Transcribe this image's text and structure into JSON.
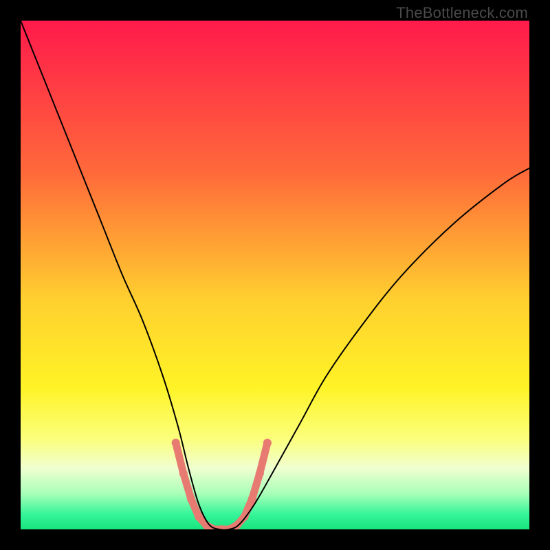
{
  "watermark": "TheBottleneck.com",
  "chart_data": {
    "type": "line",
    "title": "",
    "xlabel": "",
    "ylabel": "",
    "xlim": [
      0,
      100
    ],
    "ylim": [
      0,
      100
    ],
    "background_gradient": {
      "stops": [
        {
          "offset": 0.0,
          "color": "#ff1a4b"
        },
        {
          "offset": 0.3,
          "color": "#ff6a3a"
        },
        {
          "offset": 0.55,
          "color": "#ffd02f"
        },
        {
          "offset": 0.72,
          "color": "#fff326"
        },
        {
          "offset": 0.82,
          "color": "#fbff7a"
        },
        {
          "offset": 0.88,
          "color": "#f0ffd0"
        },
        {
          "offset": 0.93,
          "color": "#a8ffb7"
        },
        {
          "offset": 0.97,
          "color": "#36f59a"
        },
        {
          "offset": 1.0,
          "color": "#18e47e"
        }
      ]
    },
    "series": [
      {
        "name": "bottleneck-curve",
        "color": "#000000",
        "stroke_width": 2,
        "x": [
          0,
          4,
          8,
          12,
          16,
          20,
          24,
          28,
          31,
          33,
          35,
          37,
          39,
          41,
          43,
          46,
          50,
          55,
          60,
          67,
          75,
          85,
          95,
          100
        ],
        "y": [
          100,
          90,
          80,
          70,
          60,
          50,
          41,
          30,
          20,
          12,
          5,
          1,
          0,
          0,
          1,
          5,
          12,
          21,
          30,
          40,
          50,
          60,
          68,
          71
        ]
      },
      {
        "name": "highlight-segment",
        "color": "#e77b72",
        "stroke_width": 11,
        "x": [
          30.5,
          32,
          33.5,
          35,
          36.5,
          38,
          39.5,
          41,
          42.5,
          44,
          45.5,
          47,
          48.5
        ],
        "y": [
          17,
          11,
          6,
          2.5,
          0.8,
          0,
          0,
          0,
          0.8,
          2.5,
          6,
          11,
          17
        ]
      }
    ]
  }
}
